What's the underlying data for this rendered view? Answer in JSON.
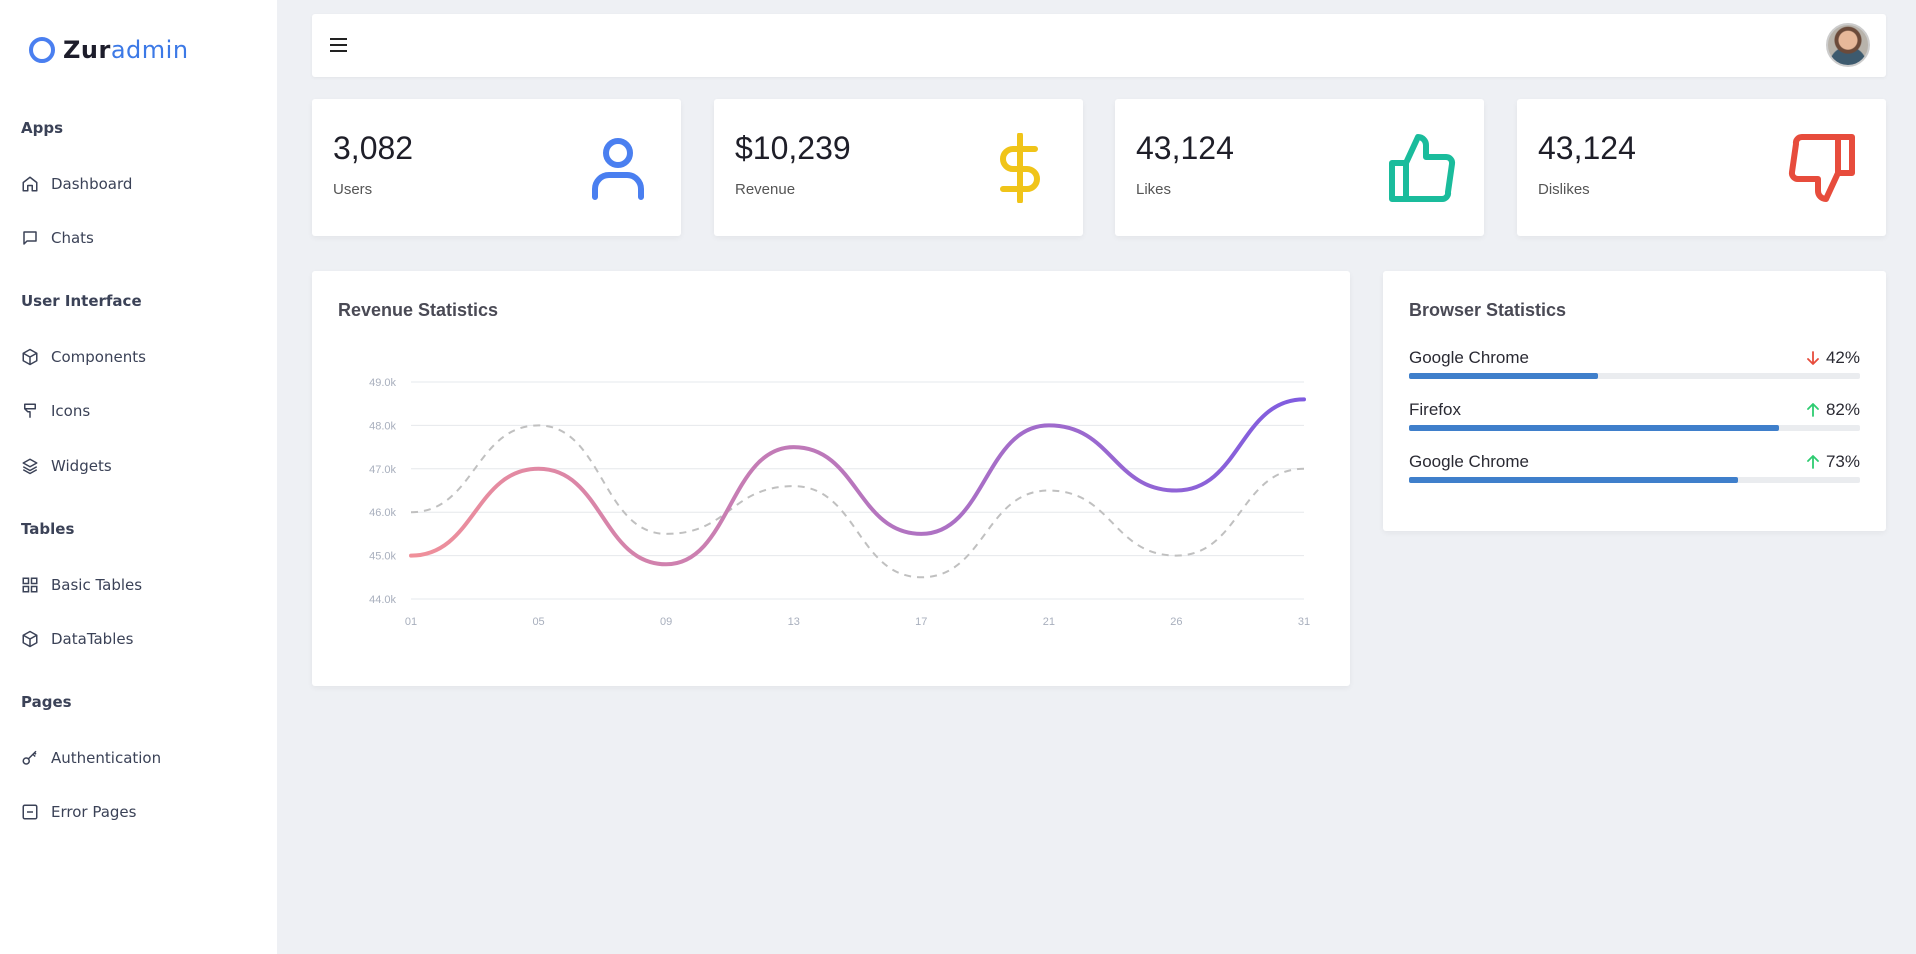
{
  "brand": {
    "part1": "Zur",
    "part2": "admin"
  },
  "sidebar": {
    "sections": [
      {
        "title": "Apps",
        "items": [
          {
            "label": "Dashboard",
            "icon": "home-icon"
          },
          {
            "label": "Chats",
            "icon": "chat-icon"
          }
        ]
      },
      {
        "title": "User Interface",
        "items": [
          {
            "label": "Components",
            "icon": "box-icon"
          },
          {
            "label": "Icons",
            "icon": "brush-icon"
          },
          {
            "label": "Widgets",
            "icon": "layers-icon"
          }
        ]
      },
      {
        "title": "Tables",
        "items": [
          {
            "label": "Basic Tables",
            "icon": "grid-icon"
          },
          {
            "label": "DataTables",
            "icon": "box-icon"
          }
        ]
      },
      {
        "title": "Pages",
        "items": [
          {
            "label": "Authentication",
            "icon": "key-icon"
          },
          {
            "label": "Error Pages",
            "icon": "minus-square-icon"
          }
        ]
      }
    ]
  },
  "stats": [
    {
      "value": "3,082",
      "label": "Users",
      "icon": "user-icon",
      "color": "#4a7ff0"
    },
    {
      "value": "$10,239",
      "label": "Revenue",
      "icon": "dollar-icon",
      "color": "#f0c419"
    },
    {
      "value": "43,124",
      "label": "Likes",
      "icon": "thumbs-up-icon",
      "color": "#1abc9c"
    },
    {
      "value": "43,124",
      "label": "Dislikes",
      "icon": "thumbs-down-icon",
      "color": "#e74c3c"
    }
  ],
  "revenue": {
    "title": "Revenue Statistics",
    "chart_data": {
      "type": "line",
      "categories": [
        "01",
        "05",
        "09",
        "13",
        "17",
        "21",
        "26",
        "31"
      ],
      "y_ticks": [
        "44.0k",
        "45.0k",
        "46.0k",
        "47.0k",
        "48.0k",
        "49.0k"
      ],
      "ylim": [
        44.0,
        49.0
      ],
      "series": [
        {
          "values": [
            45.0,
            47.0,
            44.8,
            47.5,
            45.5,
            48.0,
            46.5,
            48.6
          ],
          "style": "solid-gradient",
          "colors": [
            "#f0909a",
            "#7f5ce0"
          ]
        },
        {
          "values": [
            46.0,
            48.0,
            45.5,
            46.6,
            44.5,
            46.5,
            45.0,
            47.0
          ],
          "style": "dashed",
          "colors": [
            "#c0c0c0"
          ]
        }
      ],
      "grid": true
    }
  },
  "browser": {
    "title": "Browser Statistics",
    "rows": [
      {
        "name": "Google Chrome",
        "pct": "42%",
        "value": 0.42,
        "trend": "down",
        "trend_color": "#e74c3c"
      },
      {
        "name": "Firefox",
        "pct": "82%",
        "value": 0.82,
        "trend": "up",
        "trend_color": "#2ecc71"
      },
      {
        "name": "Google Chrome",
        "pct": "73%",
        "value": 0.73,
        "trend": "up",
        "trend_color": "#2ecc71"
      }
    ],
    "bar_color": "#3f7fcb"
  }
}
